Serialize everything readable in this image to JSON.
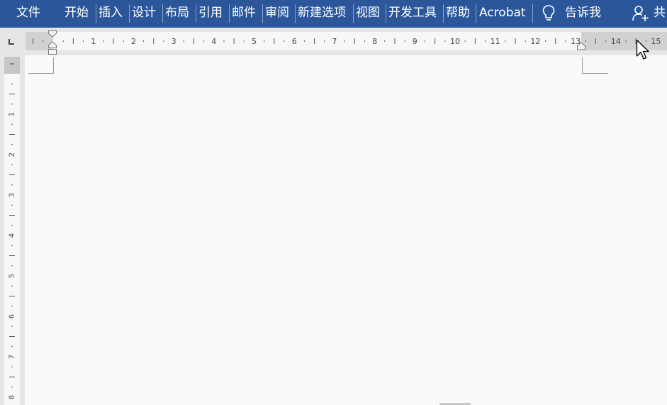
{
  "ribbon": {
    "tabs": [
      "文件",
      "开始",
      "插入",
      "设计",
      "布局",
      "引用",
      "邮件",
      "审阅",
      "新建选项",
      "视图",
      "开发工具",
      "帮助",
      "Acrobat"
    ],
    "tell_me_label": "告诉我",
    "share_label": "共"
  },
  "ruler": {
    "horizontal_numbers": [
      "1",
      "2",
      "3",
      "4",
      "5",
      "6",
      "7",
      "8",
      "9",
      "10",
      "11",
      "12",
      "13",
      "14",
      "15"
    ],
    "vertical_numbers": [
      "1",
      "2",
      "3",
      "4",
      "5",
      "6",
      "7",
      "8"
    ]
  },
  "colors": {
    "ribbon_blue": "#2b579a",
    "ruler_margin_gray": "#d1d1d1",
    "ruler_white": "#f7f7f7",
    "page_background": "#fafafa"
  },
  "icons": {
    "tell_me": "lightbulb-icon",
    "share": "person-add-icon",
    "tab_selector": "left-tab-stop-icon",
    "cursor": "mouse-pointer-icon"
  }
}
